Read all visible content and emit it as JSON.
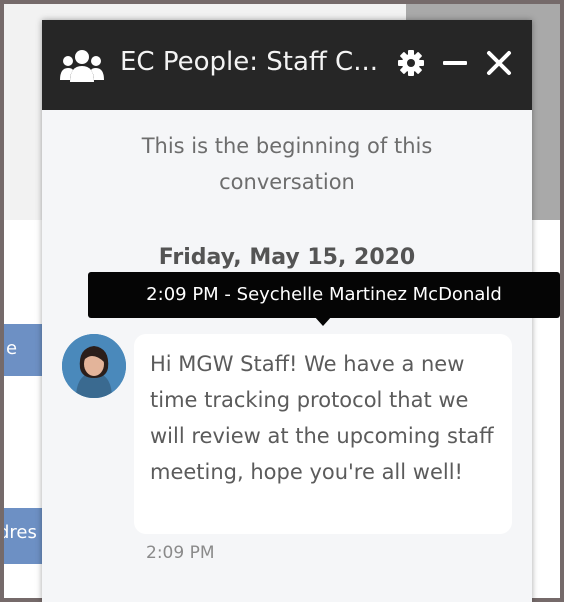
{
  "background": {
    "chip_one_text": "e",
    "chip_two_text": "dres"
  },
  "chat": {
    "title": "EC People: Staff C...",
    "header_icons": [
      "group-icon",
      "gear-icon",
      "minimize-icon",
      "close-icon"
    ],
    "conversation_start": "This is the beginning of this conversation",
    "date_separator": "Friday, May 15, 2020",
    "tooltip": "2:09 PM - Seychelle Martinez McDonald",
    "message": {
      "text": "Hi MGW Staff! We have a new time tracking protocol that we will review at the upcoming staff meeting, hope you're all well!",
      "time": "2:09 PM"
    }
  },
  "colors": {
    "header": "#262626",
    "window": "#f5f6f8",
    "tooltip": "#050505",
    "chip": "#6d90c4"
  }
}
